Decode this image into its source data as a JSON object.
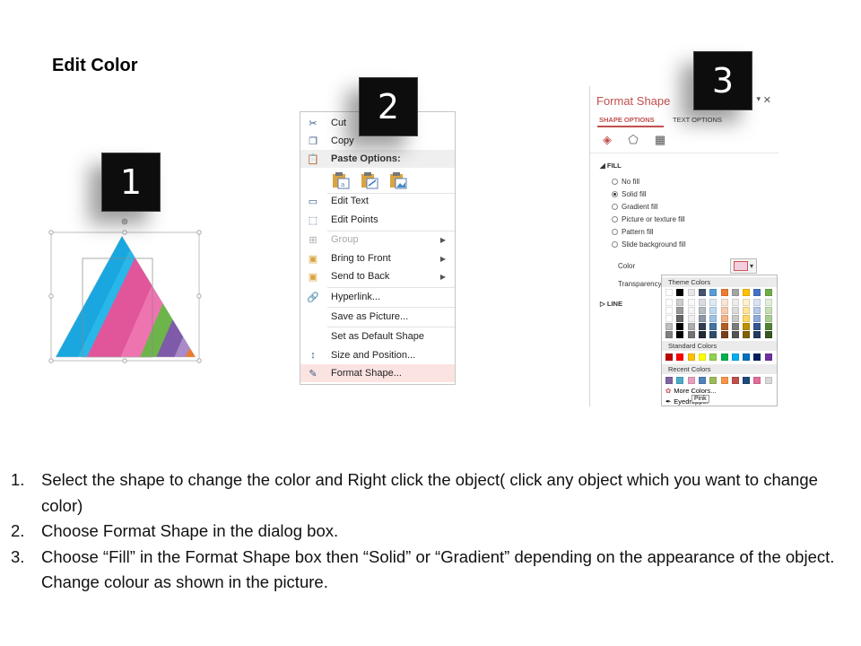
{
  "title": "Edit Color",
  "badges": [
    "1",
    "2",
    "3"
  ],
  "context_menu": {
    "items": [
      {
        "icon": "cut-icon",
        "label": "Cut"
      },
      {
        "icon": "copy-icon",
        "label": "Copy"
      },
      {
        "icon": "paste-icon",
        "label": "Paste Options:"
      },
      {
        "icon": "edit-text-icon",
        "label": "Edit Text"
      },
      {
        "icon": "edit-points-icon",
        "label": "Edit Points"
      },
      {
        "icon": "group-icon",
        "label": "Group"
      },
      {
        "icon": "bring-to-front-icon",
        "label": "Bring to Front"
      },
      {
        "icon": "send-to-back-icon",
        "label": "Send to Back"
      },
      {
        "icon": "hyperlink-icon",
        "label": "Hyperlink..."
      },
      {
        "icon": "",
        "label": "Save as Picture..."
      },
      {
        "icon": "",
        "label": "Set as Default Shape"
      },
      {
        "icon": "size-position-icon",
        "label": "Size and Position..."
      },
      {
        "icon": "format-shape-icon",
        "label": "Format Shape..."
      }
    ]
  },
  "format_panel": {
    "title": "Format Shape",
    "tabs": [
      "SHAPE OPTIONS",
      "TEXT OPTIONS"
    ],
    "fill_section": "FILL",
    "fill_options": [
      "No fill",
      "Solid fill",
      "Gradient fill",
      "Picture or texture fill",
      "Pattern fill",
      "Slide background fill"
    ],
    "selected_fill": "Solid fill",
    "color_label": "Color",
    "transparency_label": "Transparency",
    "line_section": "LINE"
  },
  "palette": {
    "theme_header": "Theme Colors",
    "standard_header": "Standard Colors",
    "recent_header": "Recent Colors",
    "more_colors": "More Colors...",
    "eyedropper": "Eyedropper",
    "tooltip": "Pink",
    "theme_top": [
      "#ffffff",
      "#000000",
      "#e7e6e6",
      "#44546a",
      "#5b9bd5",
      "#ed7d31",
      "#a5a5a5",
      "#ffc000",
      "#4472c4",
      "#70ad47"
    ],
    "standard": [
      "#c00000",
      "#ff0000",
      "#ffc000",
      "#ffff00",
      "#92d050",
      "#00b050",
      "#00b0f0",
      "#0070c0",
      "#002060",
      "#7030a0"
    ],
    "recent": [
      "#8064a2",
      "#4bacc6",
      "#e8a0c0",
      "#4f81bd",
      "#9bbb59",
      "#f79646",
      "#c0504d",
      "#1f497d",
      "#e36c9a",
      "#d9d9d9"
    ]
  },
  "instructions": [
    {
      "num": "1.",
      "text": "Select the shape to change the color and Right click the object( click any object which you want to change color)"
    },
    {
      "num": "2.",
      "text": "Choose Format Shape in the dialog box."
    },
    {
      "num": "3.",
      "text": "Choose “Fill” in the Format Shape box then “Solid” or “Gradient” depending on the appearance of the object. Change colour as shown in the picture."
    }
  ]
}
